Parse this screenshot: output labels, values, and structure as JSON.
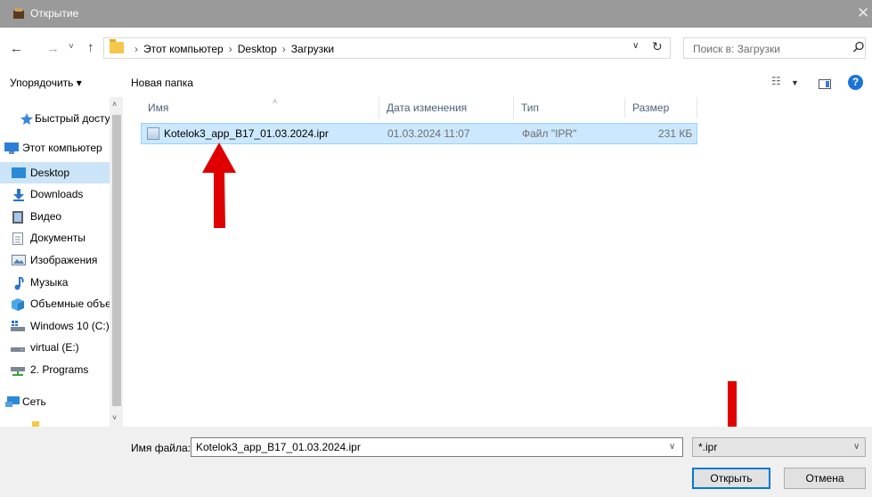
{
  "window": {
    "title": "Открытие",
    "close_glyph": "✕"
  },
  "nav": {
    "back_glyph": "←",
    "forward_glyph": "→",
    "recent_glyph": "˅",
    "up_glyph": "↑",
    "breadcrumbs": [
      "Этот компьютер",
      "Desktop",
      "Загрузки"
    ],
    "crumb_separator": "›",
    "dropdown_glyph": "∨",
    "refresh_glyph": "↻"
  },
  "search": {
    "placeholder": "Поиск в: Загрузки",
    "icon": "search-icon"
  },
  "toolbar": {
    "organize_label": "Упорядочить ▾",
    "new_folder_label": "Новая папка",
    "view_glyph": "☷",
    "view_dd_glyph": "▼",
    "help_label": "?"
  },
  "sidebar": {
    "items": [
      {
        "label": "Быстрый доступ",
        "icon": "star-icon"
      },
      {
        "label": "Этот компьютер",
        "icon": "computer-icon"
      },
      {
        "label": "Desktop",
        "icon": "desktop-icon",
        "selected": true
      },
      {
        "label": "Downloads",
        "icon": "download-icon"
      },
      {
        "label": "Видео",
        "icon": "video-icon"
      },
      {
        "label": "Документы",
        "icon": "documents-icon"
      },
      {
        "label": "Изображения",
        "icon": "pictures-icon"
      },
      {
        "label": "Музыка",
        "icon": "music-icon"
      },
      {
        "label": "Объемные объекты",
        "icon": "3d-objects-icon"
      },
      {
        "label": "Windows 10 (C:)",
        "icon": "system-drive-icon"
      },
      {
        "label": "virtual (E:)",
        "icon": "drive-icon"
      },
      {
        "label": "2. Programs",
        "icon": "network-drive-icon"
      },
      {
        "label": "Сеть",
        "icon": "network-icon"
      }
    ],
    "scroll_up_glyph": "˄",
    "scroll_down_glyph": "˅"
  },
  "columns": {
    "name": "Имя",
    "date": "Дата изменения",
    "type": "Тип",
    "size": "Размер",
    "sort_glyph": "˄"
  },
  "files": [
    {
      "name": "Kotelok3_app_B17_01.03.2024.ipr",
      "date": "01.03.2024 11:07",
      "type": "Файл \"IPR\"",
      "size": "231 КБ"
    }
  ],
  "footer": {
    "filename_label": "Имя файла:",
    "filename_value": "Kotelok3_app_B17_01.03.2024.ipr",
    "filetype_value": "*.ipr",
    "dd_glyph": "∨",
    "open_label": "Открыть",
    "cancel_label": "Отмена"
  },
  "colors": {
    "titlebar": "#9a9a9a",
    "selection": "#cce8ff",
    "annotation_arrow": "#e00000",
    "accent": "#0078d7"
  }
}
